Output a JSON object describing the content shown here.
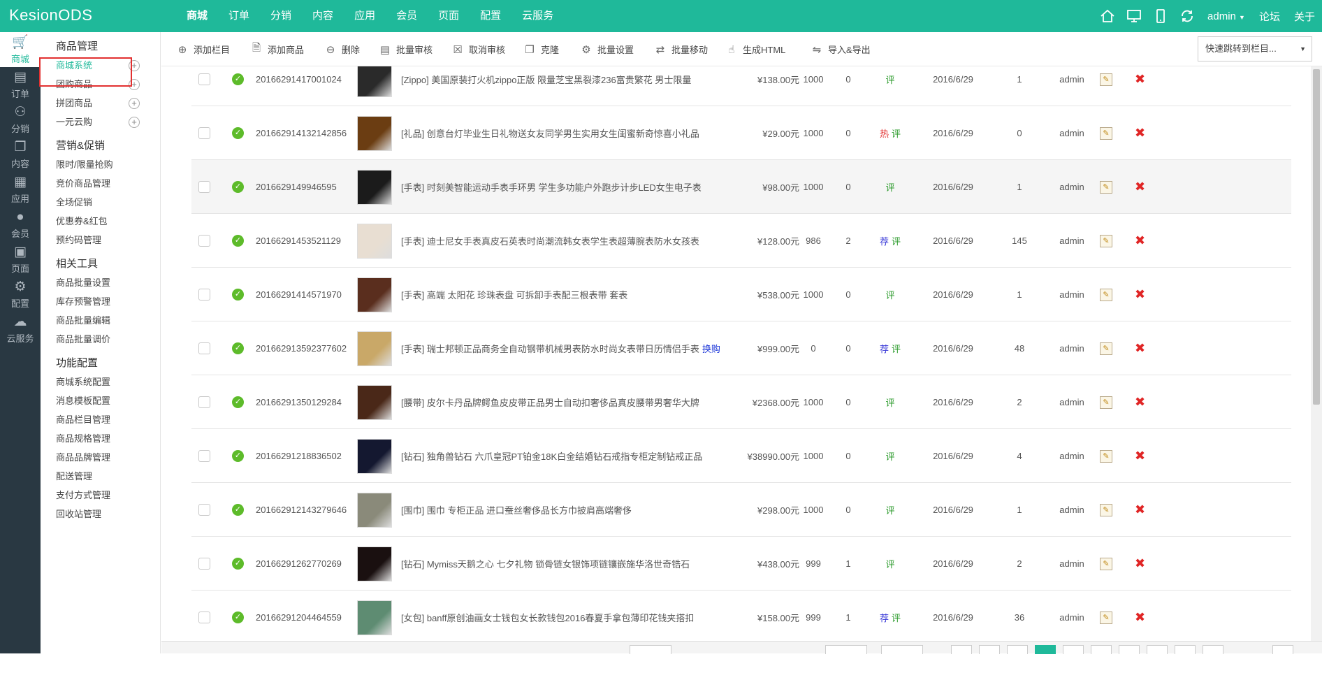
{
  "app": {
    "logo": "KesionODS"
  },
  "topnav": [
    "商城",
    "订单",
    "分销",
    "内容",
    "应用",
    "会员",
    "页面",
    "配置",
    "云服务"
  ],
  "topright": {
    "user": "admin",
    "forum": "论坛",
    "about": "关于"
  },
  "iconbar": [
    {
      "label": "商城",
      "icon": "cart-icon"
    },
    {
      "label": "订单",
      "icon": "clipboard-icon"
    },
    {
      "label": "分销",
      "icon": "network-icon"
    },
    {
      "label": "内容",
      "icon": "documents-icon"
    },
    {
      "label": "应用",
      "icon": "grid-icon"
    },
    {
      "label": "会员",
      "icon": "user-icon"
    },
    {
      "label": "页面",
      "icon": "pages-icon"
    },
    {
      "label": "配置",
      "icon": "gear-icon"
    },
    {
      "label": "云服务",
      "icon": "cloud-icon"
    }
  ],
  "sidebar": [
    {
      "title": "商品管理",
      "items": [
        "商城系统",
        "团购商品",
        "拼团商品",
        "一元云购"
      ]
    },
    {
      "title": "营销&促销",
      "items": [
        "限时/限量抢购",
        "竞价商品管理",
        "全场促销",
        "优惠券&红包",
        "预约码管理"
      ]
    },
    {
      "title": "相关工具",
      "items": [
        "商品批量设置",
        "库存预警管理",
        "商品批量编辑",
        "商品批量调价"
      ]
    },
    {
      "title": "功能配置",
      "items": [
        "商城系统配置",
        "消息模板配置",
        "商品栏目管理",
        "商品规格管理",
        "商品品牌管理",
        "配送管理",
        "支付方式管理",
        "回收站管理"
      ]
    }
  ],
  "toolbar": [
    {
      "label": "添加栏目",
      "icon": "plus-circle-icon"
    },
    {
      "label": "添加商品",
      "icon": "add-doc-icon"
    },
    {
      "label": "删除",
      "icon": "minus-circle-icon"
    },
    {
      "label": "批量审核",
      "icon": "clipboard-check-icon"
    },
    {
      "label": "取消审核",
      "icon": "x-box-icon"
    },
    {
      "label": "克隆",
      "icon": "copy-icon"
    },
    {
      "label": "批量设置",
      "icon": "gears-icon"
    },
    {
      "label": "批量移动",
      "icon": "move-icon"
    },
    {
      "label": "生成HTML",
      "icon": "hand-pointer-icon"
    },
    {
      "label": "导入&导出",
      "icon": "import-export-icon"
    }
  ],
  "jump": {
    "label": "快速跳转到栏目..."
  },
  "rows": [
    {
      "id": "20166291417001024",
      "title": "[Zippo] 美国原装打火机zippo正版 限量芝宝黑裂漆236富贵繁花 男士限量",
      "price": "¥138.00元",
      "stock": "1000",
      "sold": "0",
      "hot": "",
      "rec": "",
      "ping": "评",
      "date": "2016/6/29",
      "hits": "1",
      "user": "admin",
      "thumb": "#2a2a2a"
    },
    {
      "id": "20166291413214285​6",
      "title": "[礼品] 创意台灯毕业生日礼物送女友同学男生实用女生闺蜜新奇惊喜小礼品",
      "price": "¥29.00元",
      "stock": "1000",
      "sold": "0",
      "hot": "热",
      "rec": "",
      "ping": "评",
      "date": "2016/6/29",
      "hits": "0",
      "user": "admin",
      "thumb": "#6b3d12"
    },
    {
      "id": "20166291499​46595",
      "title": "[手表] 时刻美智能运动手表手环男 学生多功能户外跑步计步LED女生电子表",
      "price": "¥98.00元",
      "stock": "1000",
      "sold": "0",
      "hot": "",
      "rec": "",
      "ping": "评",
      "date": "2016/6/29",
      "hits": "1",
      "user": "admin",
      "thumb": "#1b1b1b"
    },
    {
      "id": "20166291453521129",
      "title": "[手表] 迪士尼女手表真皮石英表时尚潮流韩女表学生表超薄腕表防水女孩表",
      "price": "¥128.00元",
      "stock": "986",
      "sold": "2",
      "hot": "",
      "rec": "荐",
      "ping": "评",
      "date": "2016/6/29",
      "hits": "145",
      "user": "admin",
      "thumb": "#e8ded2"
    },
    {
      "id": "20166291414571970",
      "title": "[手表] 高端 太阳花 珍珠表盘 可拆卸手表配三根表带 套表",
      "price": "¥538.00元",
      "stock": "1000",
      "sold": "0",
      "hot": "",
      "rec": "",
      "ping": "评",
      "date": "2016/6/29",
      "hits": "1",
      "user": "admin",
      "thumb": "#5a2e1e"
    },
    {
      "id": "20166291359237​7602",
      "title": "[手表] 瑞士邦顿正品商务全自动钢带机械男表防水时尚女表带日历情侣手表",
      "link": "换购",
      "price": "¥999.00元",
      "stock": "0",
      "sold": "0",
      "hot": "",
      "rec": "荐",
      "ping": "评",
      "date": "2016/6/29",
      "hits": "48",
      "user": "admin",
      "thumb": "#c9a868"
    },
    {
      "id": "20166291350129284",
      "title": "[腰带] 皮尔卡丹品牌鳄鱼皮皮带正品男士自动扣奢侈品真皮腰带男奢华大牌",
      "price": "¥2368.00元",
      "stock": "1000",
      "sold": "0",
      "hot": "",
      "rec": "",
      "ping": "评",
      "date": "2016/6/29",
      "hits": "2",
      "user": "admin",
      "thumb": "#4a2818"
    },
    {
      "id": "20166291218836502",
      "title": "[钻石] 独角兽钻石 六爪皇冠PT铂金18K白金结婚钻石戒指专柜定制钻戒正品",
      "price": "¥38990.00元",
      "stock": "1000",
      "sold": "0",
      "hot": "",
      "rec": "",
      "ping": "评",
      "date": "2016/6/29",
      "hits": "4",
      "user": "admin",
      "thumb": "#141830"
    },
    {
      "id": "20166291214327​9646",
      "title": "[围巾] 围巾 专柜正品 进口蚕丝奢侈品长方巾披肩高端奢侈",
      "price": "¥298.00元",
      "stock": "1000",
      "sold": "0",
      "hot": "",
      "rec": "",
      "ping": "评",
      "date": "2016/6/29",
      "hits": "1",
      "user": "admin",
      "thumb": "#8a8a7a"
    },
    {
      "id": "20166291262770269",
      "title": "[钻石] Mymiss天鹅之心 七夕礼物 锁骨链女银饰项链镶嵌施华洛世奇锆石",
      "price": "¥438.00元",
      "stock": "999",
      "sold": "1",
      "hot": "",
      "rec": "",
      "ping": "评",
      "date": "2016/6/29",
      "hits": "2",
      "user": "admin",
      "thumb": "#1a1010"
    },
    {
      "id": "20166291204464559",
      "title": "[女包] banff原创油画女士钱包女长款钱包2016春夏手拿包薄印花钱夹搭扣",
      "price": "¥158.00元",
      "stock": "999",
      "sold": "1",
      "hot": "",
      "rec": "荐",
      "ping": "评",
      "date": "2016/6/29",
      "hits": "36",
      "user": "admin",
      "thumb": "#5e8c72"
    }
  ]
}
